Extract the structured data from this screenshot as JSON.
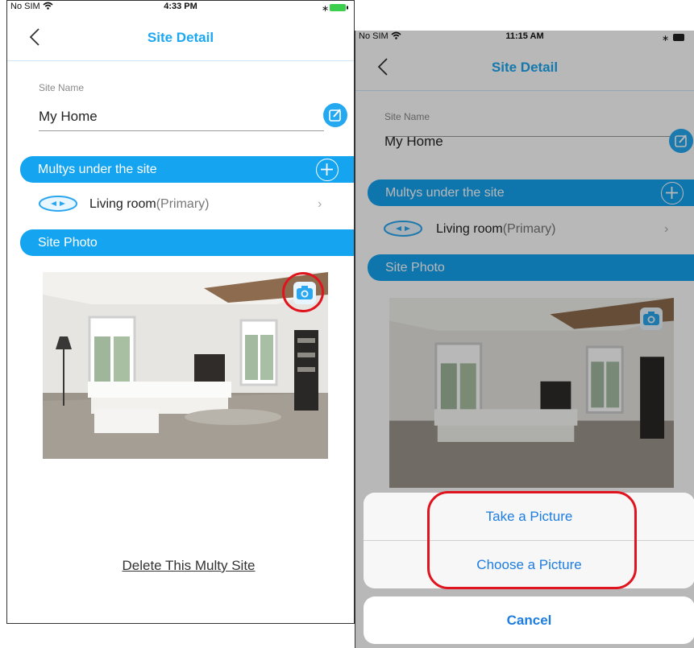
{
  "left": {
    "status": {
      "carrier": "No SIM",
      "time": "4:33 PM"
    },
    "nav": {
      "title": "Site Detail"
    },
    "site": {
      "label": "Site Name",
      "value": "My Home"
    },
    "multys": {
      "header": "Multys under the site",
      "device_name": "Living room",
      "device_role": "(Primary)"
    },
    "photo": {
      "header": "Site Photo"
    },
    "delete_label": "Delete This Multy Site"
  },
  "right": {
    "status": {
      "carrier": "No SIM",
      "time": "11:15 AM"
    },
    "nav": {
      "title": "Site Detail"
    },
    "site": {
      "label": "Site Name",
      "value": "My Home"
    },
    "multys": {
      "header": "Multys under the site",
      "device_name": "Living room",
      "device_role": "(Primary)"
    },
    "photo": {
      "header": "Site Photo"
    },
    "sheet": {
      "take_picture": "Take a Picture",
      "choose_picture": "Choose a Picture",
      "cancel": "Cancel"
    }
  },
  "colors": {
    "accent": "#15a4f0",
    "title_blue": "#1da7f0",
    "highlight_red": "#e0141e",
    "action_blue": "#1d7de0"
  },
  "icons": [
    "wifi-icon",
    "bluetooth-icon",
    "battery-icon",
    "back-chevron-icon",
    "edit-icon",
    "plus-icon",
    "router-icon",
    "chevron-right-icon",
    "camera-icon"
  ]
}
